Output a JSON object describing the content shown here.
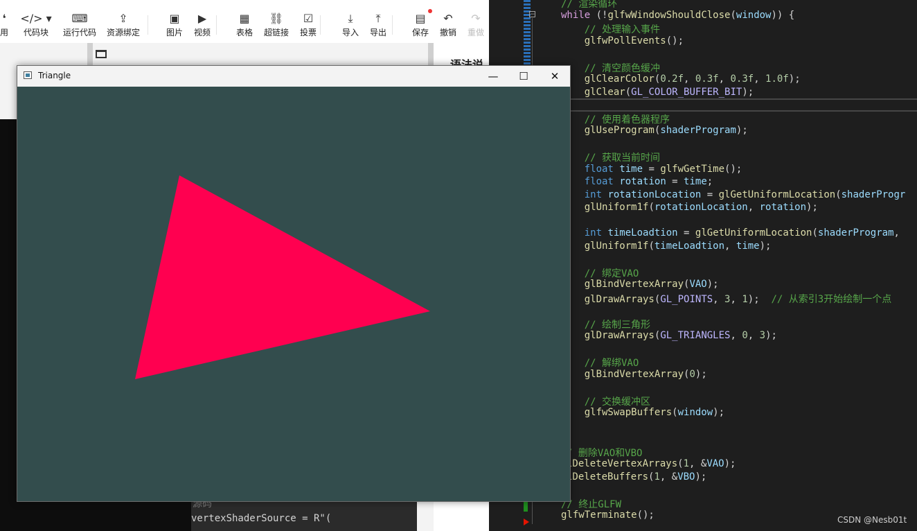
{
  "editor": {
    "toolbar": [
      {
        "icon": "quote-icon",
        "glyph": "❛",
        "label": "用"
      },
      {
        "icon": "code-icon",
        "glyph": "</> ▾",
        "label": "代码块"
      },
      {
        "icon": "run-code-icon",
        "glyph": "⌨",
        "label": "运行代码"
      },
      {
        "icon": "upload-icon",
        "glyph": "⇪",
        "label": "资源绑定"
      },
      {
        "icon": "image-icon",
        "glyph": "▣",
        "label": "图片"
      },
      {
        "icon": "video-icon",
        "glyph": "▶",
        "label": "视频"
      },
      {
        "icon": "table-icon",
        "glyph": "▦",
        "label": "表格"
      },
      {
        "icon": "link-icon",
        "glyph": "⛓",
        "label": "超链接"
      },
      {
        "icon": "vote-icon",
        "glyph": "☑",
        "label": "投票"
      },
      {
        "icon": "import-icon",
        "glyph": "⤓",
        "label": "导入"
      },
      {
        "icon": "export-icon",
        "glyph": "⤒",
        "label": "导出"
      },
      {
        "icon": "save-icon",
        "glyph": "▤",
        "label": "保存"
      },
      {
        "icon": "undo-icon",
        "glyph": "↶",
        "label": "撤销"
      },
      {
        "icon": "redo-icon",
        "glyph": "↷",
        "label": "重做"
      }
    ],
    "preview_heading": "语法说",
    "code_lines": [
      "源码",
      "vertexShaderSource = R\"("
    ]
  },
  "glfw_window": {
    "title": "Triangle",
    "minimize_glyph": "—",
    "maximize_glyph": "☐",
    "close_glyph": "✕",
    "clear_color": "#334d4d",
    "triangle_color": "#ff0050"
  },
  "code": {
    "lines": [
      [
        [
          "cm",
          "// 渲染循环"
        ]
      ],
      [
        [
          "kw2",
          "while"
        ],
        [
          "pn",
          " (!"
        ],
        [
          "fn",
          "glfwWindowShouldClose"
        ],
        [
          "pn",
          "("
        ],
        [
          "vr",
          "window"
        ],
        [
          "pn",
          ")) {"
        ]
      ],
      [
        [
          "pn",
          "    "
        ],
        [
          "cm",
          "// 处理输入事件"
        ]
      ],
      [
        [
          "pn",
          "    "
        ],
        [
          "fn",
          "glfwPollEvents"
        ],
        [
          "pn",
          "();"
        ]
      ],
      [],
      [
        [
          "pn",
          "    "
        ],
        [
          "cm",
          "// 清空颜色缓冲"
        ]
      ],
      [
        [
          "pn",
          "    "
        ],
        [
          "fn",
          "glClearColor"
        ],
        [
          "pn",
          "("
        ],
        [
          "nm",
          "0.2f"
        ],
        [
          "pn",
          ", "
        ],
        [
          "nm",
          "0.3f"
        ],
        [
          "pn",
          ", "
        ],
        [
          "nm",
          "0.3f"
        ],
        [
          "pn",
          ", "
        ],
        [
          "nm",
          "1.0f"
        ],
        [
          "pn",
          ");"
        ]
      ],
      [
        [
          "pn",
          "    "
        ],
        [
          "fn",
          "glClear"
        ],
        [
          "pn",
          "("
        ],
        [
          "mc",
          "GL_COLOR_BUFFER_BIT"
        ],
        [
          "pn",
          ");"
        ]
      ],
      [],
      [
        [
          "pn",
          "    "
        ],
        [
          "cm",
          "// 使用着色器程序"
        ]
      ],
      [
        [
          "pn",
          "    "
        ],
        [
          "fn",
          "glUseProgram"
        ],
        [
          "pn",
          "("
        ],
        [
          "vr",
          "shaderProgram"
        ],
        [
          "pn",
          ");"
        ]
      ],
      [],
      [
        [
          "pn",
          "    "
        ],
        [
          "cm",
          "// 获取当前时间"
        ]
      ],
      [
        [
          "pn",
          "    "
        ],
        [
          "kw",
          "float"
        ],
        [
          "pn",
          " "
        ],
        [
          "vr",
          "time"
        ],
        [
          "pn",
          " = "
        ],
        [
          "fn",
          "glfwGetTime"
        ],
        [
          "pn",
          "();"
        ]
      ],
      [
        [
          "pn",
          "    "
        ],
        [
          "kw",
          "float"
        ],
        [
          "pn",
          " "
        ],
        [
          "vr",
          "rotation"
        ],
        [
          "pn",
          " = "
        ],
        [
          "vr",
          "time"
        ],
        [
          "pn",
          ";"
        ]
      ],
      [
        [
          "pn",
          "    "
        ],
        [
          "kw",
          "int"
        ],
        [
          "pn",
          " "
        ],
        [
          "vr",
          "rotationLocation"
        ],
        [
          "pn",
          " = "
        ],
        [
          "fn",
          "glGetUniformLocation"
        ],
        [
          "pn",
          "("
        ],
        [
          "vr",
          "shaderProgr"
        ]
      ],
      [
        [
          "pn",
          "    "
        ],
        [
          "fn",
          "glUniform1f"
        ],
        [
          "pn",
          "("
        ],
        [
          "vr",
          "rotationLocation"
        ],
        [
          "pn",
          ", "
        ],
        [
          "vr",
          "rotation"
        ],
        [
          "pn",
          ");"
        ]
      ],
      [],
      [
        [
          "pn",
          "    "
        ],
        [
          "kw",
          "int"
        ],
        [
          "pn",
          " "
        ],
        [
          "vr",
          "timeLoadtion"
        ],
        [
          "pn",
          " = "
        ],
        [
          "fn",
          "glGetUniformLocation"
        ],
        [
          "pn",
          "("
        ],
        [
          "vr",
          "shaderProgram"
        ],
        [
          "pn",
          ","
        ]
      ],
      [
        [
          "pn",
          "    "
        ],
        [
          "fn",
          "glUniform1f"
        ],
        [
          "pn",
          "("
        ],
        [
          "vr",
          "timeLoadtion"
        ],
        [
          "pn",
          ", "
        ],
        [
          "vr",
          "time"
        ],
        [
          "pn",
          ");"
        ]
      ],
      [],
      [
        [
          "pn",
          "    "
        ],
        [
          "cm",
          "// 绑定VAO"
        ]
      ],
      [
        [
          "pn",
          "    "
        ],
        [
          "fn",
          "glBindVertexArray"
        ],
        [
          "pn",
          "("
        ],
        [
          "vr",
          "VAO"
        ],
        [
          "pn",
          ");"
        ]
      ],
      [
        [
          "pn",
          "    "
        ],
        [
          "fn",
          "glDrawArrays"
        ],
        [
          "pn",
          "("
        ],
        [
          "mc",
          "GL_POINTS"
        ],
        [
          "pn",
          ", "
        ],
        [
          "nm",
          "3"
        ],
        [
          "pn",
          ", "
        ],
        [
          "nm",
          "1"
        ],
        [
          "pn",
          ");  "
        ],
        [
          "cm",
          "// 从索引3开始绘制一个点"
        ]
      ],
      [],
      [
        [
          "pn",
          "    "
        ],
        [
          "cm",
          "// 绘制三角形"
        ]
      ],
      [
        [
          "pn",
          "    "
        ],
        [
          "fn",
          "glDrawArrays"
        ],
        [
          "pn",
          "("
        ],
        [
          "mc",
          "GL_TRIANGLES"
        ],
        [
          "pn",
          ", "
        ],
        [
          "nm",
          "0"
        ],
        [
          "pn",
          ", "
        ],
        [
          "nm",
          "3"
        ],
        [
          "pn",
          ");"
        ]
      ],
      [],
      [
        [
          "pn",
          "    "
        ],
        [
          "cm",
          "// 解绑VAO"
        ]
      ],
      [
        [
          "pn",
          "    "
        ],
        [
          "fn",
          "glBindVertexArray"
        ],
        [
          "pn",
          "("
        ],
        [
          "nm",
          "0"
        ],
        [
          "pn",
          ");"
        ]
      ],
      [],
      [
        [
          "pn",
          "    "
        ],
        [
          "cm",
          "// 交换缓冲区"
        ]
      ],
      [
        [
          "pn",
          "    "
        ],
        [
          "fn",
          "glfwSwapBuffers"
        ],
        [
          "pn",
          "("
        ],
        [
          "vr",
          "window"
        ],
        [
          "pn",
          ");"
        ]
      ],
      [],
      [],
      [
        [
          "cm",
          "/ 删除VAO和VBO"
        ]
      ],
      [
        [
          "fn",
          "lDeleteVertexArrays"
        ],
        [
          "pn",
          "("
        ],
        [
          "nm",
          "1"
        ],
        [
          "pn",
          ", &"
        ],
        [
          "vr",
          "VAO"
        ],
        [
          "pn",
          ");"
        ]
      ],
      [
        [
          "fn",
          "lDeleteBuffers"
        ],
        [
          "pn",
          "("
        ],
        [
          "nm",
          "1"
        ],
        [
          "pn",
          ", &"
        ],
        [
          "vr",
          "VBO"
        ],
        [
          "pn",
          ");"
        ]
      ],
      [],
      [
        [
          "cm",
          "// 终止GLFW"
        ]
      ],
      [
        [
          "fn",
          "glfwTerminate"
        ],
        [
          "pn",
          "();"
        ]
      ]
    ]
  },
  "watermark": "CSDN @Nesb01t"
}
